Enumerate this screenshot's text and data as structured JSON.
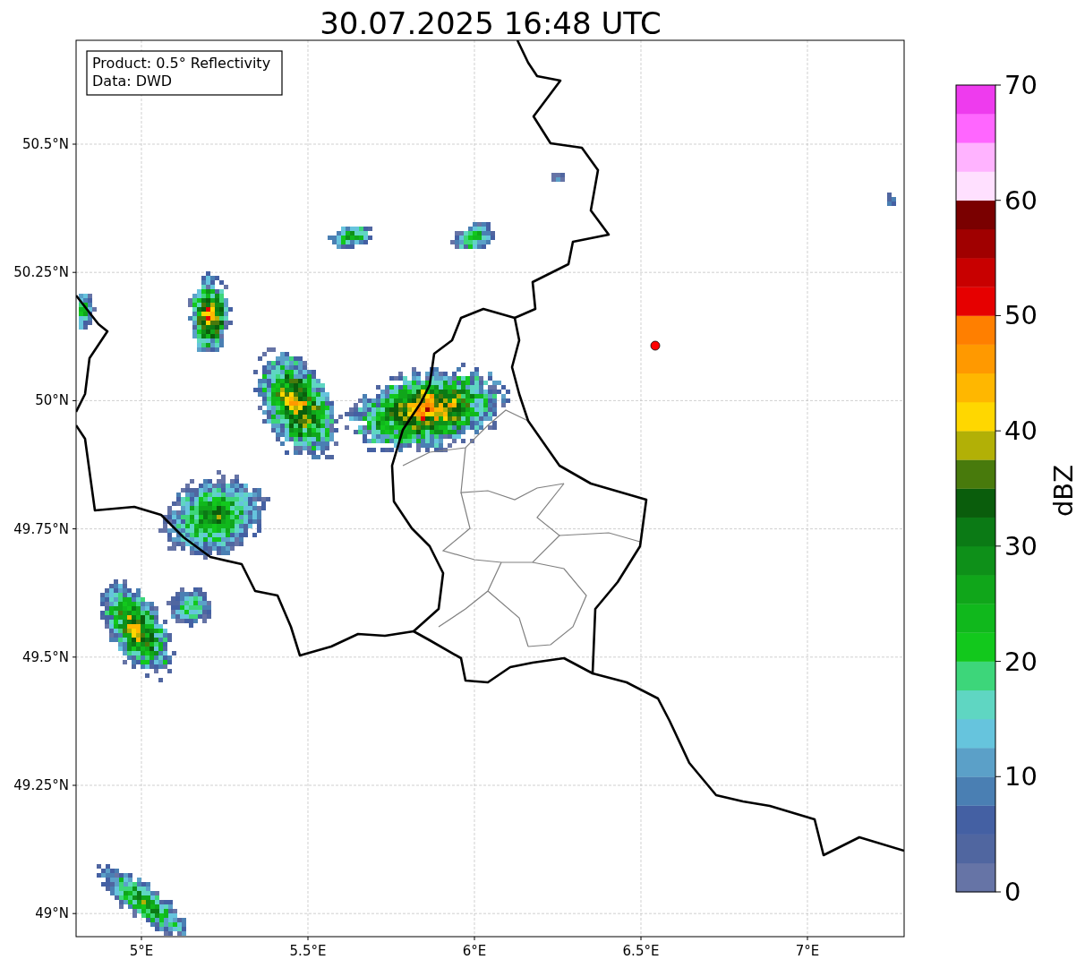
{
  "title": "30.07.2025 16:48 UTC",
  "info_box": [
    "Product: 0.5° Reflectivity",
    "Data: DWD"
  ],
  "map": {
    "lat_ticks": [
      "50.5°N",
      "50.25°N",
      "50°N",
      "49.75°N",
      "49.5°N",
      "49.25°N",
      "49°N"
    ],
    "lon_ticks": [
      "5°E",
      "5.5°E",
      "6°E",
      "6.5°E",
      "7°E"
    ]
  },
  "colorbar": {
    "label": "dBZ",
    "ticks": [
      "70",
      "60",
      "50",
      "40",
      "30",
      "20",
      "10",
      "0"
    ],
    "segments": [
      {
        "color": "#6674a6"
      },
      {
        "color": "#5066a0"
      },
      {
        "color": "#4460a3"
      },
      {
        "color": "#4a7fb3"
      },
      {
        "color": "#5ba0c8"
      },
      {
        "color": "#66c4dd"
      },
      {
        "color": "#5fd6c2"
      },
      {
        "color": "#3dd67a"
      },
      {
        "color": "#12c81c"
      },
      {
        "color": "#10b81c"
      },
      {
        "color": "#10a61a"
      },
      {
        "color": "#0e9019"
      },
      {
        "color": "#0b7a15"
      },
      {
        "color": "#0a5d0c"
      },
      {
        "color": "#487a0c"
      },
      {
        "color": "#b2b006"
      },
      {
        "color": "#ffd700"
      },
      {
        "color": "#ffb700"
      },
      {
        "color": "#ff9900"
      },
      {
        "color": "#ff7f00"
      },
      {
        "color": "#e60000"
      },
      {
        "color": "#c80000"
      },
      {
        "color": "#a00000"
      },
      {
        "color": "#7a0000"
      },
      {
        "color": "#ffe0ff"
      },
      {
        "color": "#ffb3ff"
      },
      {
        "color": "#ff66ff"
      },
      {
        "color": "#ee3bee"
      }
    ]
  }
}
